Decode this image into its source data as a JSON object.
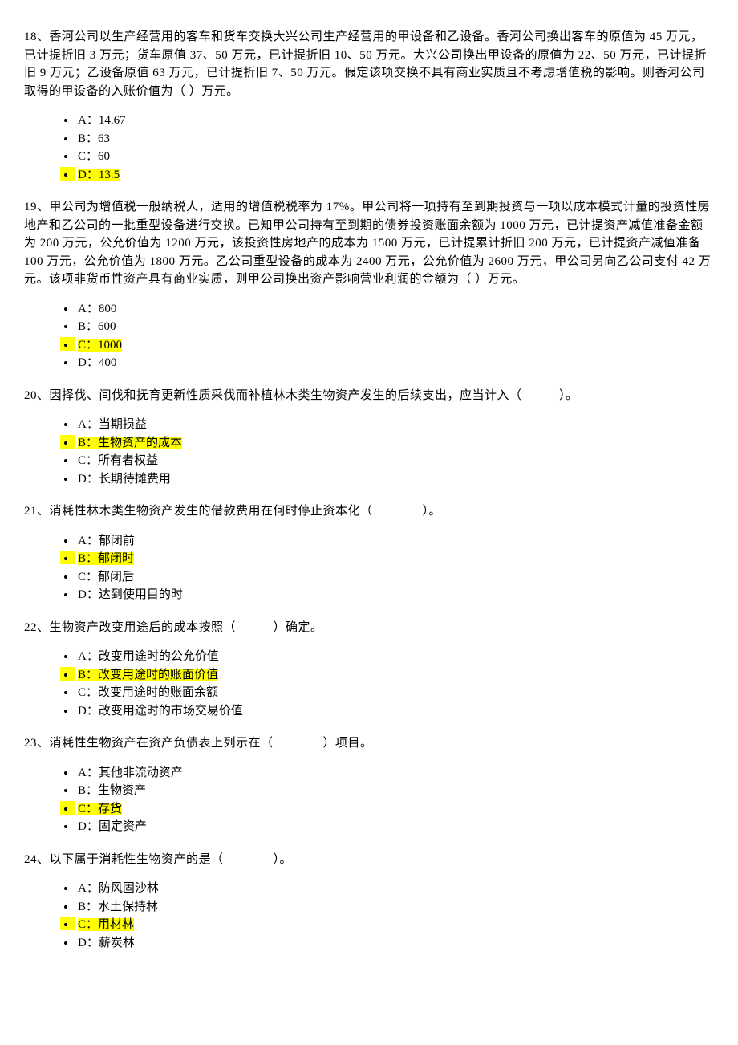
{
  "questions": [
    {
      "number": "18",
      "text": "18、香河公司以生产经营用的客车和货车交换大兴公司生产经营用的甲设备和乙设备。香河公司换出客车的原值为 45 万元，已计提折旧 3 万元；货车原值 37、50 万元，已计提折旧 10、50 万元。大兴公司换出甲设备的原值为 22、50 万元，已计提折旧 9 万元；乙设备原值 63 万元，已计提折旧 7、50 万元。假定该项交换不具有商业实质且不考虑增值税的影响。则香河公司取得的甲设备的入账价值为（ ）万元。",
      "options": [
        {
          "label": "A：14.67",
          "highlighted": false
        },
        {
          "label": "B：63",
          "highlighted": false
        },
        {
          "label": "C：60",
          "highlighted": false
        },
        {
          "label": "D：13.5",
          "highlighted": true
        }
      ]
    },
    {
      "number": "19",
      "text": "19、甲公司为增值税一般纳税人，适用的增值税税率为 17%。甲公司将一项持有至到期投资与一项以成本模式计量的投资性房地产和乙公司的一批重型设备进行交换。已知甲公司持有至到期的债券投资账面余额为 1000 万元，已计提资产减值准备金额为 200 万元，公允价值为 1200 万元，该投资性房地产的成本为 1500 万元，已计提累计折旧 200 万元，已计提资产减值准备 100 万元，公允价值为 1800 万元。乙公司重型设备的成本为 2400 万元，公允价值为 2600 万元，甲公司另向乙公司支付 42 万元。该项非货币性资产具有商业实质，则甲公司换出资产影响营业利润的金额为（ ）万元。",
      "options": [
        {
          "label": "A：800",
          "highlighted": false
        },
        {
          "label": "B：600",
          "highlighted": false
        },
        {
          "label": "C：1000",
          "highlighted": true
        },
        {
          "label": "D：400",
          "highlighted": false
        }
      ]
    },
    {
      "number": "20",
      "text": "20、因择伐、间伐和抚育更新性质采伐而补植林木类生物资产发生的后续支出，应当计入（　　　）。",
      "options": [
        {
          "label": "A：当期损益",
          "highlighted": false
        },
        {
          "label": "B：生物资产的成本",
          "highlighted": true
        },
        {
          "label": "C：所有者权益",
          "highlighted": false
        },
        {
          "label": "D：长期待摊费用",
          "highlighted": false
        }
      ]
    },
    {
      "number": "21",
      "text": "21、消耗性林木类生物资产发生的借款费用在何时停止资本化（　　　　）。",
      "options": [
        {
          "label": "A：郁闭前",
          "highlighted": false
        },
        {
          "label": "B：郁闭时",
          "highlighted": true
        },
        {
          "label": "C：郁闭后",
          "highlighted": false
        },
        {
          "label": "D：达到使用目的时",
          "highlighted": false
        }
      ]
    },
    {
      "number": "22",
      "text": "22、生物资产改变用途后的成本按照（　　　）确定。",
      "options": [
        {
          "label": "A：改变用途时的公允价值",
          "highlighted": false
        },
        {
          "label": "B：改变用途时的账面价值",
          "highlighted": true
        },
        {
          "label": "C：改变用途时的账面余额",
          "highlighted": false
        },
        {
          "label": "D：改变用途时的市场交易价值",
          "highlighted": false
        }
      ]
    },
    {
      "number": "23",
      "text": "23、消耗性生物资产在资产负债表上列示在（　　　　）项目。",
      "options": [
        {
          "label": "A：其他非流动资产",
          "highlighted": false
        },
        {
          "label": "B：生物资产",
          "highlighted": false
        },
        {
          "label": "C：存货",
          "highlighted": true
        },
        {
          "label": "D：固定资产",
          "highlighted": false
        }
      ]
    },
    {
      "number": "24",
      "text": "24、以下属于消耗性生物资产的是（　　　　）。",
      "options": [
        {
          "label": "A：防风固沙林",
          "highlighted": false
        },
        {
          "label": "B：水土保持林",
          "highlighted": false
        },
        {
          "label": "C：用材林",
          "highlighted": true
        },
        {
          "label": "D：薪炭林",
          "highlighted": false
        }
      ]
    }
  ]
}
